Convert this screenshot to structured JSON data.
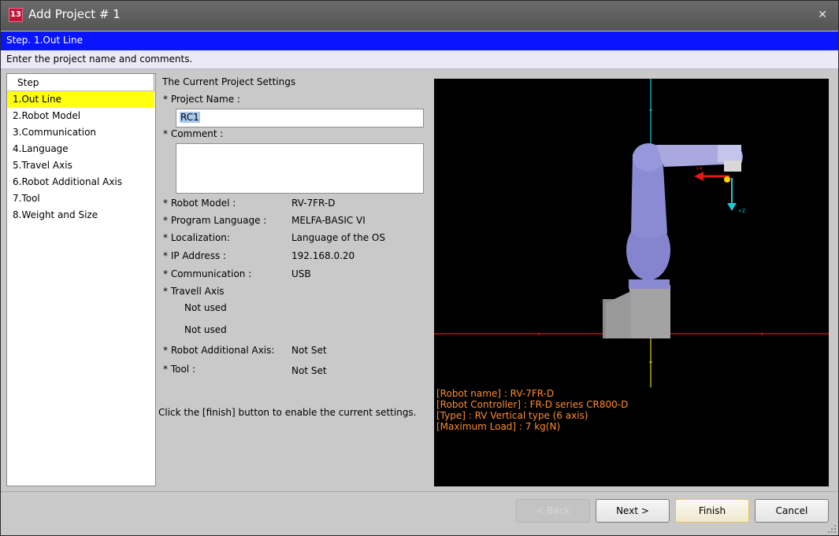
{
  "window": {
    "title": "Add Project # 1",
    "app_icon_text": "13"
  },
  "banner": {
    "step": "Step. 1.Out Line",
    "instruction": "Enter the project name and comments."
  },
  "steps": {
    "header": "Step",
    "items": [
      {
        "label": "1.Out Line",
        "active": true
      },
      {
        "label": "2.Robot Model"
      },
      {
        "label": "3.Communication"
      },
      {
        "label": "4.Language"
      },
      {
        "label": "5.Travel Axis"
      },
      {
        "label": "6.Robot Additional Axis"
      },
      {
        "label": "7.Tool"
      },
      {
        "label": "8.Weight and Size"
      }
    ]
  },
  "settings": {
    "title": "The Current Project Settings",
    "project_name_label": "* Project Name :",
    "project_name_value": "RC1",
    "comment_label": "* Comment :",
    "comment_value": "",
    "robot_model_label": "* Robot Model :",
    "robot_model_value": "RV-7FR-D",
    "program_language_label": "* Program Language :",
    "program_language_value": "MELFA-BASIC VI",
    "localization_label": "* Localization:",
    "localization_value": "Language of the OS",
    "ip_label": "* IP Address :",
    "ip_value": "192.168.0.20",
    "communication_label": "* Communication :",
    "communication_value": "USB",
    "travel_axis_label": "* Travell Axis",
    "travel_axis_value_1": "Not used",
    "travel_axis_value_2": "Not used",
    "additional_axis_label": "* Robot Additional Axis:",
    "additional_axis_value": "Not Set",
    "tool_label": "* Tool :",
    "tool_value": "Not Set",
    "finish_hint": "Click the [finish] button to enable the current settings."
  },
  "viewport": {
    "axis_labels": {
      "x": "+X",
      "z": "+Z"
    },
    "info": [
      "[Robot name] : RV-7FR-D",
      "[Robot Controller] : FR-D series CR800-D",
      "[Type] : RV Vertical type (6 axis)",
      "[Maximum Load] : 7 kg(N)"
    ]
  },
  "buttons": {
    "back": "< Back",
    "next": "Next >",
    "finish": "Finish",
    "cancel": "Cancel"
  },
  "colors": {
    "step_banner": "#0a15ff",
    "active_step": "#ffff11",
    "info_text": "#ff8c2a",
    "robot": "#8e8ed8"
  }
}
